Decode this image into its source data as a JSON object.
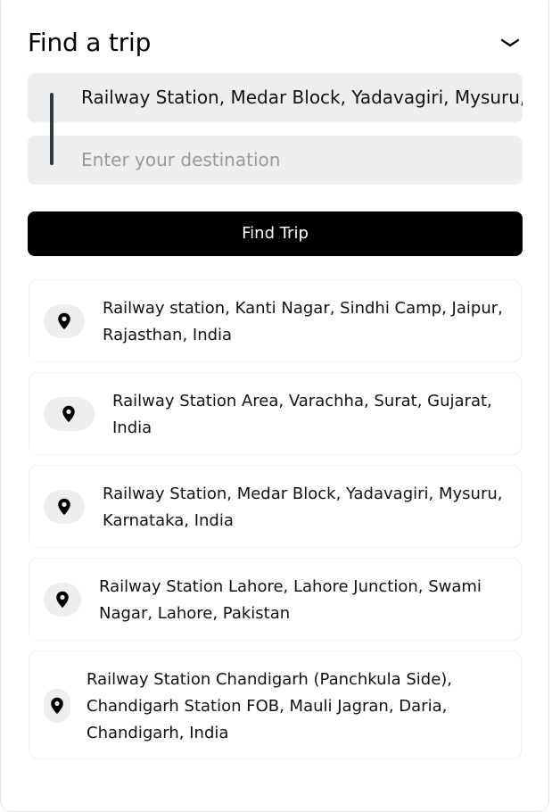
{
  "header": {
    "title": "Find a trip",
    "collapse_icon": "chevron-down-icon"
  },
  "pickup": {
    "value": "Railway Station, Medar Block, Yadavagiri, Mysuru, Karnataka, India"
  },
  "destination": {
    "placeholder": "Enter your destination"
  },
  "find_button": {
    "label": "Find Trip"
  },
  "suggestions": [
    {
      "line1": "Railway station, Kanti Nagar, Sindhi Camp, Jaipur,",
      "line2": "Rajasthan, India",
      "icon": "location-pin-icon"
    },
    {
      "line1": "Railway Station Area, Varachha, Surat, Gujarat,",
      "line2": "India",
      "icon": "location-pin-icon"
    },
    {
      "line1": "Railway Station, Medar Block, Yadavagiri, Mysuru,",
      "line2": "Karnataka, India",
      "icon": "location-pin-icon"
    },
    {
      "line1": "Railway Station Lahore, Lahore Junction, Swami",
      "line2": "Nagar, Lahore, Pakistan",
      "icon": "location-pin-icon"
    },
    {
      "line1": "Railway Station Chandigarh (Panchkula Side),",
      "line2": "Chandigarh Station FOB, Mauli Jagran, Daria,",
      "line3": "Chandigarh, India",
      "icon": "location-pin-icon"
    }
  ],
  "colors": {
    "input_bg": "#eeeeee",
    "button_bg": "#000000",
    "connector": "#2f3a44"
  }
}
